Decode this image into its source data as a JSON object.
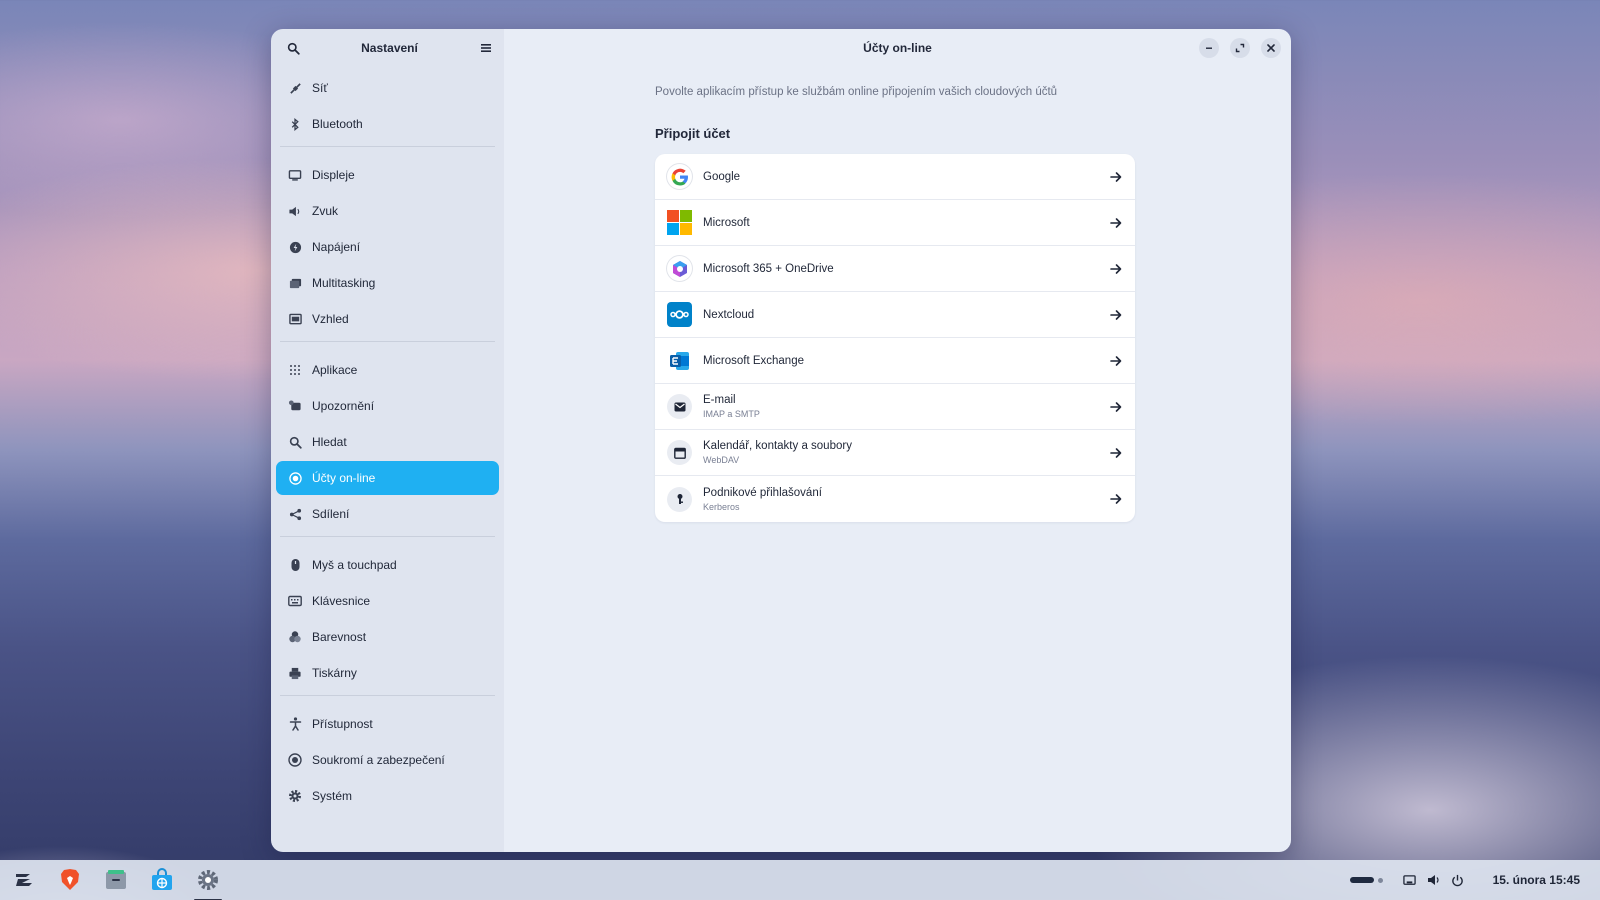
{
  "sidebar": {
    "title": "Nastavení",
    "groups": [
      [
        {
          "label": "Síť",
          "icon": "network-icon"
        },
        {
          "label": "Bluetooth",
          "icon": "bluetooth-icon"
        }
      ],
      [
        {
          "label": "Displeje",
          "icon": "display-icon"
        },
        {
          "label": "Zvuk",
          "icon": "speaker-icon"
        },
        {
          "label": "Napájení",
          "icon": "power-icon"
        },
        {
          "label": "Multitasking",
          "icon": "multitasking-icon"
        },
        {
          "label": "Vzhled",
          "icon": "appearance-icon"
        }
      ],
      [
        {
          "label": "Aplikace",
          "icon": "apps-grid-icon"
        },
        {
          "label": "Upozornění",
          "icon": "notification-icon"
        },
        {
          "label": "Hledat",
          "icon": "search-icon"
        },
        {
          "label": "Účty on-line",
          "icon": "online-accounts-icon",
          "active": true
        },
        {
          "label": "Sdílení",
          "icon": "share-icon"
        }
      ],
      [
        {
          "label": "Myš a touchpad",
          "icon": "mouse-icon"
        },
        {
          "label": "Klávesnice",
          "icon": "keyboard-icon"
        },
        {
          "label": "Barevnost",
          "icon": "color-icon"
        },
        {
          "label": "Tiskárny",
          "icon": "printer-icon"
        }
      ],
      [
        {
          "label": "Přístupnost",
          "icon": "accessibility-icon"
        },
        {
          "label": "Soukromí a zabezpečení",
          "icon": "privacy-icon"
        },
        {
          "label": "Systém",
          "icon": "gear-icon"
        }
      ]
    ]
  },
  "content": {
    "title": "Účty on-line",
    "intro": "Povolte aplikacím přístup ke službám online připojením vašich cloudových účtů",
    "section_title": "Připojit účet",
    "accounts": [
      {
        "name": "Google",
        "subtitle": "",
        "icon": "google-icon"
      },
      {
        "name": "Microsoft",
        "subtitle": "",
        "icon": "microsoft-icon"
      },
      {
        "name": "Microsoft 365 + OneDrive",
        "subtitle": "",
        "icon": "microsoft365-icon"
      },
      {
        "name": "Nextcloud",
        "subtitle": "",
        "icon": "nextcloud-icon"
      },
      {
        "name": "Microsoft Exchange",
        "subtitle": "",
        "icon": "exchange-icon"
      },
      {
        "name": "E-mail",
        "subtitle": "IMAP a SMTP",
        "icon": "mail-icon"
      },
      {
        "name": "Kalendář, kontakty a soubory",
        "subtitle": "WebDAV",
        "icon": "calendar-icon"
      },
      {
        "name": "Podnikové přihlašování",
        "subtitle": "Kerberos",
        "icon": "kerberos-icon"
      }
    ]
  },
  "taskbar": {
    "apps": [
      {
        "name": "zorin-menu-icon"
      },
      {
        "name": "brave-browser-icon"
      },
      {
        "name": "files-icon"
      },
      {
        "name": "software-store-icon"
      },
      {
        "name": "settings-app-icon",
        "active": true
      }
    ],
    "clock": "15. února  15:45"
  },
  "colors": {
    "accent": "#1fb0f2",
    "sidebar_bg": "#dfe4ef",
    "content_bg": "#e8edf6"
  }
}
